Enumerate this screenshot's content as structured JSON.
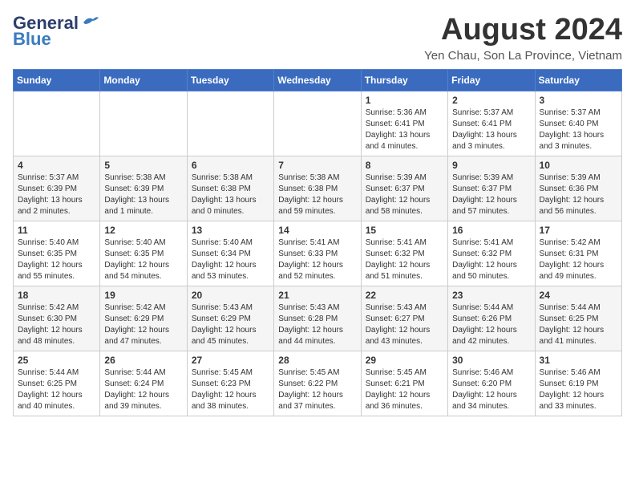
{
  "header": {
    "logo_line1": "General",
    "logo_line2": "Blue",
    "main_title": "August 2024",
    "subtitle": "Yen Chau, Son La Province, Vietnam"
  },
  "weekdays": [
    "Sunday",
    "Monday",
    "Tuesday",
    "Wednesday",
    "Thursday",
    "Friday",
    "Saturday"
  ],
  "weeks": [
    [
      {
        "day": "",
        "info": ""
      },
      {
        "day": "",
        "info": ""
      },
      {
        "day": "",
        "info": ""
      },
      {
        "day": "",
        "info": ""
      },
      {
        "day": "1",
        "info": "Sunrise: 5:36 AM\nSunset: 6:41 PM\nDaylight: 13 hours\nand 4 minutes."
      },
      {
        "day": "2",
        "info": "Sunrise: 5:37 AM\nSunset: 6:41 PM\nDaylight: 13 hours\nand 3 minutes."
      },
      {
        "day": "3",
        "info": "Sunrise: 5:37 AM\nSunset: 6:40 PM\nDaylight: 13 hours\nand 3 minutes."
      }
    ],
    [
      {
        "day": "4",
        "info": "Sunrise: 5:37 AM\nSunset: 6:39 PM\nDaylight: 13 hours\nand 2 minutes."
      },
      {
        "day": "5",
        "info": "Sunrise: 5:38 AM\nSunset: 6:39 PM\nDaylight: 13 hours\nand 1 minute."
      },
      {
        "day": "6",
        "info": "Sunrise: 5:38 AM\nSunset: 6:38 PM\nDaylight: 13 hours\nand 0 minutes."
      },
      {
        "day": "7",
        "info": "Sunrise: 5:38 AM\nSunset: 6:38 PM\nDaylight: 12 hours\nand 59 minutes."
      },
      {
        "day": "8",
        "info": "Sunrise: 5:39 AM\nSunset: 6:37 PM\nDaylight: 12 hours\nand 58 minutes."
      },
      {
        "day": "9",
        "info": "Sunrise: 5:39 AM\nSunset: 6:37 PM\nDaylight: 12 hours\nand 57 minutes."
      },
      {
        "day": "10",
        "info": "Sunrise: 5:39 AM\nSunset: 6:36 PM\nDaylight: 12 hours\nand 56 minutes."
      }
    ],
    [
      {
        "day": "11",
        "info": "Sunrise: 5:40 AM\nSunset: 6:35 PM\nDaylight: 12 hours\nand 55 minutes."
      },
      {
        "day": "12",
        "info": "Sunrise: 5:40 AM\nSunset: 6:35 PM\nDaylight: 12 hours\nand 54 minutes."
      },
      {
        "day": "13",
        "info": "Sunrise: 5:40 AM\nSunset: 6:34 PM\nDaylight: 12 hours\nand 53 minutes."
      },
      {
        "day": "14",
        "info": "Sunrise: 5:41 AM\nSunset: 6:33 PM\nDaylight: 12 hours\nand 52 minutes."
      },
      {
        "day": "15",
        "info": "Sunrise: 5:41 AM\nSunset: 6:32 PM\nDaylight: 12 hours\nand 51 minutes."
      },
      {
        "day": "16",
        "info": "Sunrise: 5:41 AM\nSunset: 6:32 PM\nDaylight: 12 hours\nand 50 minutes."
      },
      {
        "day": "17",
        "info": "Sunrise: 5:42 AM\nSunset: 6:31 PM\nDaylight: 12 hours\nand 49 minutes."
      }
    ],
    [
      {
        "day": "18",
        "info": "Sunrise: 5:42 AM\nSunset: 6:30 PM\nDaylight: 12 hours\nand 48 minutes."
      },
      {
        "day": "19",
        "info": "Sunrise: 5:42 AM\nSunset: 6:29 PM\nDaylight: 12 hours\nand 47 minutes."
      },
      {
        "day": "20",
        "info": "Sunrise: 5:43 AM\nSunset: 6:29 PM\nDaylight: 12 hours\nand 45 minutes."
      },
      {
        "day": "21",
        "info": "Sunrise: 5:43 AM\nSunset: 6:28 PM\nDaylight: 12 hours\nand 44 minutes."
      },
      {
        "day": "22",
        "info": "Sunrise: 5:43 AM\nSunset: 6:27 PM\nDaylight: 12 hours\nand 43 minutes."
      },
      {
        "day": "23",
        "info": "Sunrise: 5:44 AM\nSunset: 6:26 PM\nDaylight: 12 hours\nand 42 minutes."
      },
      {
        "day": "24",
        "info": "Sunrise: 5:44 AM\nSunset: 6:25 PM\nDaylight: 12 hours\nand 41 minutes."
      }
    ],
    [
      {
        "day": "25",
        "info": "Sunrise: 5:44 AM\nSunset: 6:25 PM\nDaylight: 12 hours\nand 40 minutes."
      },
      {
        "day": "26",
        "info": "Sunrise: 5:44 AM\nSunset: 6:24 PM\nDaylight: 12 hours\nand 39 minutes."
      },
      {
        "day": "27",
        "info": "Sunrise: 5:45 AM\nSunset: 6:23 PM\nDaylight: 12 hours\nand 38 minutes."
      },
      {
        "day": "28",
        "info": "Sunrise: 5:45 AM\nSunset: 6:22 PM\nDaylight: 12 hours\nand 37 minutes."
      },
      {
        "day": "29",
        "info": "Sunrise: 5:45 AM\nSunset: 6:21 PM\nDaylight: 12 hours\nand 36 minutes."
      },
      {
        "day": "30",
        "info": "Sunrise: 5:46 AM\nSunset: 6:20 PM\nDaylight: 12 hours\nand 34 minutes."
      },
      {
        "day": "31",
        "info": "Sunrise: 5:46 AM\nSunset: 6:19 PM\nDaylight: 12 hours\nand 33 minutes."
      }
    ]
  ]
}
